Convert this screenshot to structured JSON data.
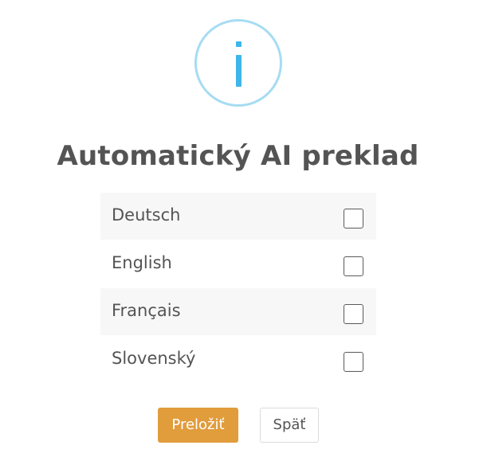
{
  "dialog": {
    "icon": "info-icon",
    "title": "Automatický AI preklad",
    "languages": [
      {
        "label": "Deutsch",
        "checked": false
      },
      {
        "label": "English",
        "checked": false
      },
      {
        "label": "Français",
        "checked": false
      },
      {
        "label": "Slovenský",
        "checked": false
      }
    ],
    "confirm_label": "Preložiť",
    "back_label": "Späť"
  },
  "colors": {
    "icon_ring": "#a6dcf2",
    "icon_glyph": "#3fb6ea",
    "primary_button": "#e19c3c",
    "text": "#545454"
  }
}
